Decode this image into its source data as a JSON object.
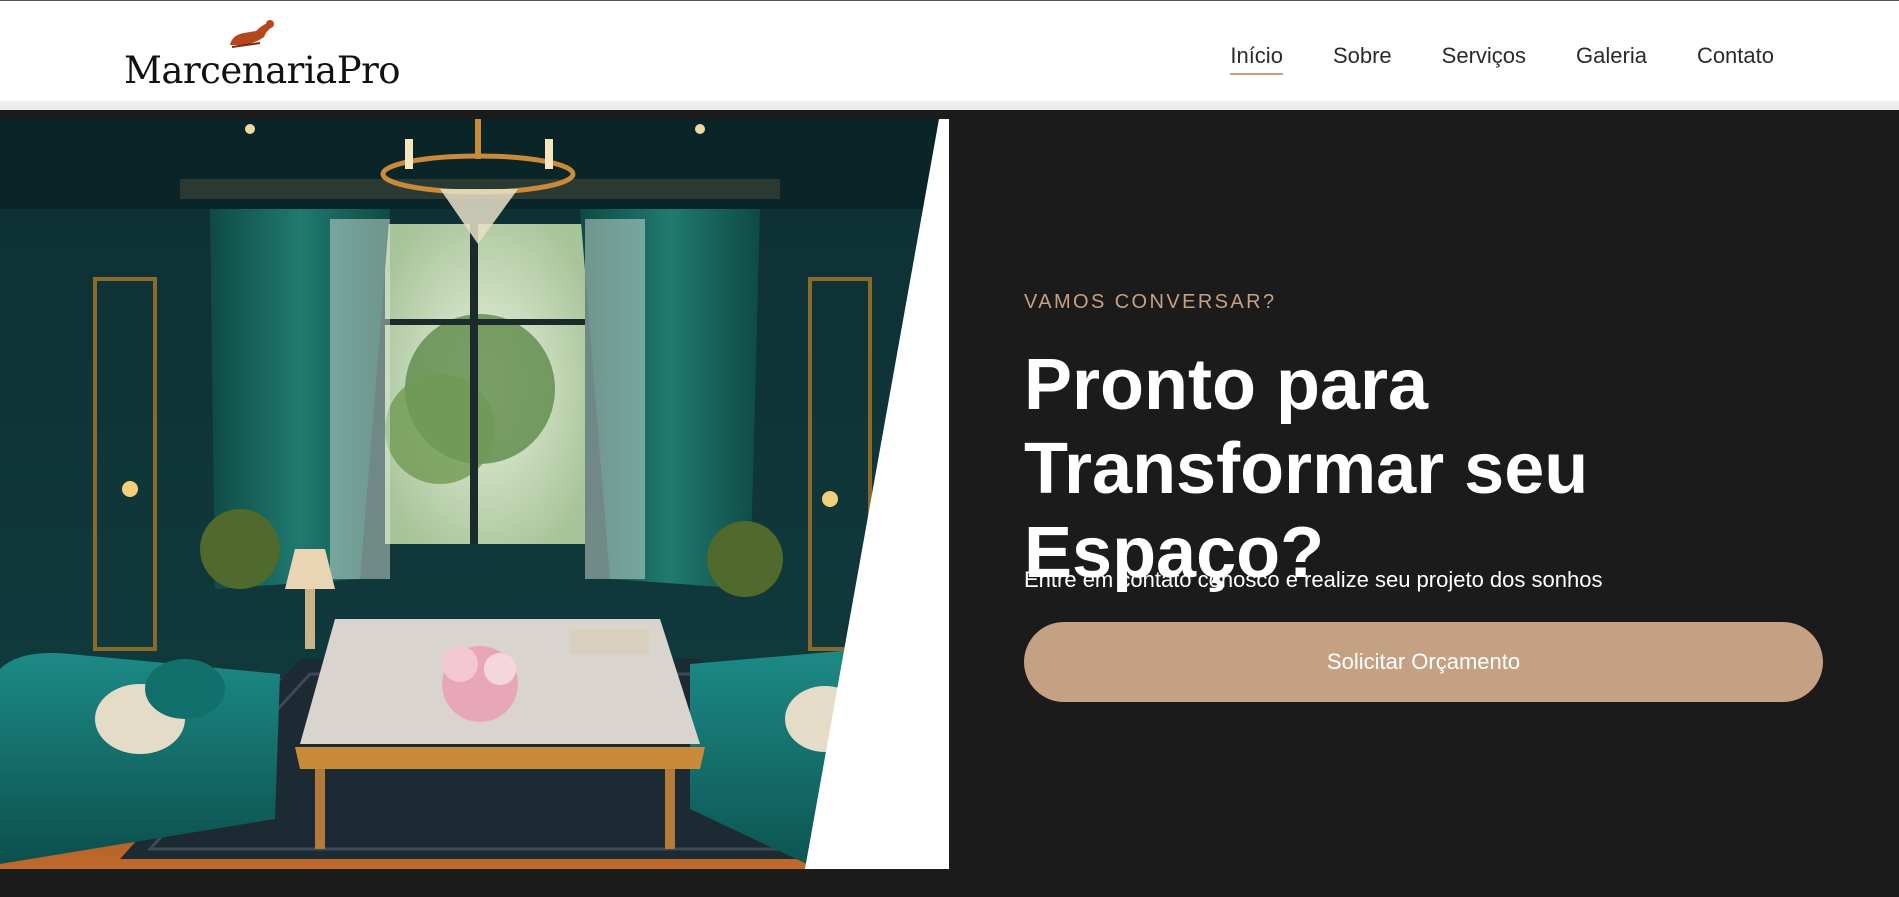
{
  "header": {
    "logo_text": "MarcenariaPro",
    "logo_icon": "woodworking-plane-icon",
    "nav": [
      {
        "label": "Início",
        "active": true
      },
      {
        "label": "Sobre",
        "active": false
      },
      {
        "label": "Serviços",
        "active": false
      },
      {
        "label": "Galeria",
        "active": false
      },
      {
        "label": "Contato",
        "active": false
      }
    ]
  },
  "hero": {
    "eyebrow": "VAMOS CONVERSAR?",
    "headline": "Pronto para Transformar seu Espaço?",
    "subtext": "Entre em contato conosco e realize seu projeto dos sonhos",
    "cta_label": "Solicitar Orçamento",
    "image_subject": "luxury teal living room with velvet sofas, chandelier and marble coffee table"
  },
  "colors": {
    "accent": "#c4a183",
    "background_dark": "#1b1b1b",
    "header_bg": "#ffffff",
    "logo_icon": "#b5471c"
  }
}
